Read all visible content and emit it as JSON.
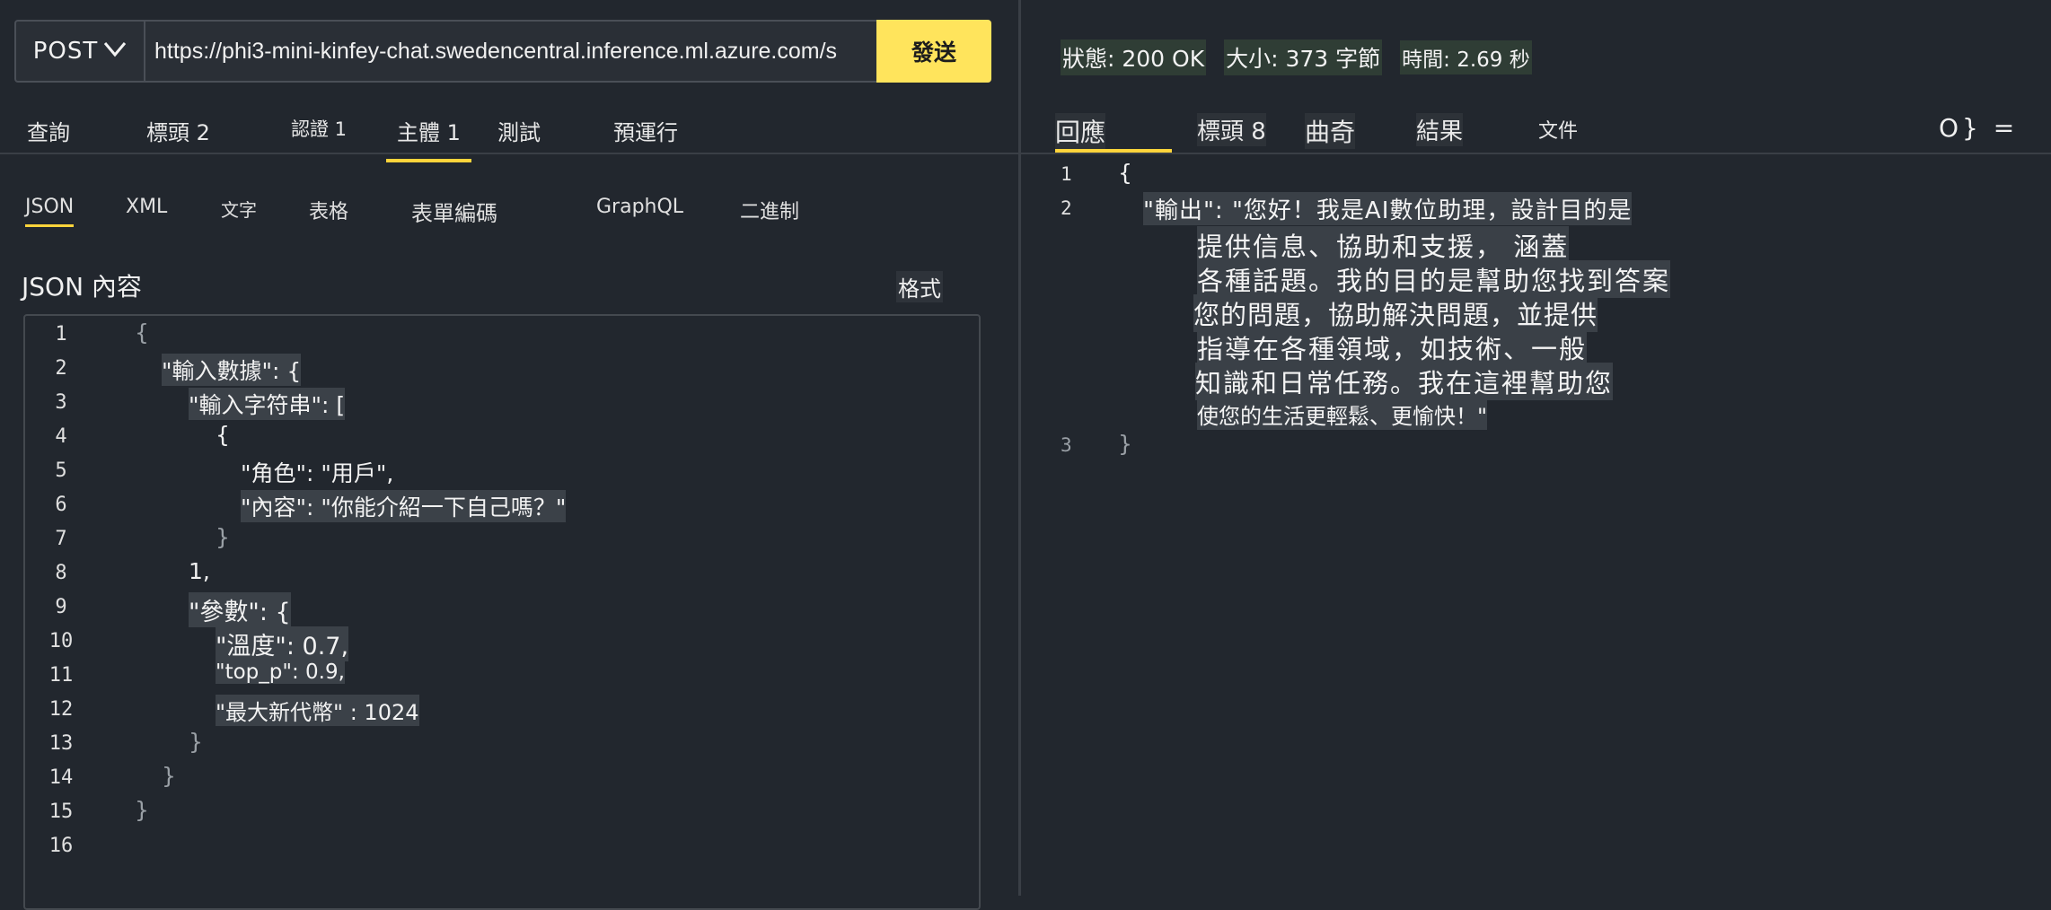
{
  "request": {
    "method": "POST",
    "url": "https://phi3-mini-kinfey-chat.swedencentral.inference.ml.azure.com/s",
    "send_label": "發送"
  },
  "request_tabs": [
    {
      "label": "查詢",
      "active": false
    },
    {
      "label": "標頭 2",
      "active": false
    },
    {
      "label": "認證 1",
      "active": false
    },
    {
      "label": "主體 1",
      "active": true
    },
    {
      "label": "測試",
      "active": false
    },
    {
      "label": "預運行",
      "active": false
    }
  ],
  "body_tabs": [
    {
      "label": "JSON",
      "active": true
    },
    {
      "label": "XML",
      "active": false
    },
    {
      "label": "文字",
      "active": false
    },
    {
      "label": "表格",
      "active": false
    },
    {
      "label": "表單編碼",
      "active": false
    },
    {
      "label": "GraphQL",
      "active": false
    },
    {
      "label": "二進制",
      "active": false
    }
  ],
  "editor": {
    "title": "JSON 內容",
    "format_label": "格式",
    "line_numbers": [
      "1",
      "2",
      "3",
      "4",
      "5",
      "6",
      "7",
      "8",
      "9",
      "10",
      "11",
      "12",
      "13",
      "14",
      "15",
      "16"
    ],
    "lines": [
      "{",
      "\"輸入數據\": {",
      "\"輸入字符串\": [",
      "{",
      "\"角色\": \"用戶\",",
      "\"內容\": \"你能介紹一下自己嗎？\"",
      "}",
      "1,",
      "\"參數\": {",
      "\"溫度\": 0.7,",
      "\"top_p\": 0.9,",
      "\"最大新代幣\" : 1024",
      "}",
      "}",
      "}",
      ""
    ]
  },
  "response": {
    "status": "狀態: 200 OK",
    "size": "大小: 373 字節",
    "time": "時間: 2.69 秒",
    "tabs": [
      {
        "label": "回應",
        "active": true
      },
      {
        "label": "標頭 8",
        "active": false
      },
      {
        "label": "曲奇",
        "active": false
      },
      {
        "label": "結果",
        "active": false
      },
      {
        "label": "文件",
        "active": false
      }
    ],
    "view_icons": "O} =",
    "line_numbers": [
      "1",
      "2",
      "3"
    ],
    "lines": [
      "{",
      "\"輸出\": \"您好！我是AI數位助理，設計目的是",
      "提供信息、協助和支援， 涵蓋",
      "各種話題。我的目的是幫助您找到答案",
      "您的問題，協助解決問題，並提供",
      "指導在各種領域，如技術、一般",
      "知識和日常任務。我在這裡幫助您",
      "使您的生活更輕鬆、更愉快！\"",
      "}"
    ]
  },
  "colors": {
    "background": "#22272e",
    "accent": "#ffd43b",
    "send_button": "#ffe45c",
    "status_bg": "#2f3d35"
  }
}
